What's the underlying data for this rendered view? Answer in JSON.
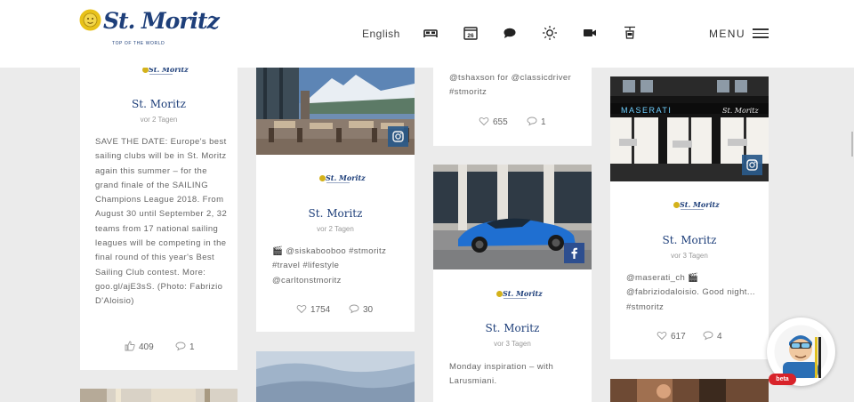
{
  "header": {
    "logo_text": "St. Moritz",
    "logo_tagline": "TOP OF THE WORLD",
    "language": "English",
    "icons": [
      "bed-icon",
      "calendar-icon",
      "chat-icon",
      "sun-icon",
      "video-camera-icon",
      "cable-car-icon"
    ],
    "calendar_day": "26",
    "menu_label": "MENU"
  },
  "cards": {
    "c1": {
      "title": "St. Moritz",
      "date": "vor 2 Tagen",
      "text": "SAVE THE DATE: Europe's best sailing clubs will be in St. Moritz again this summer – for the grand finale of the SAILING Champions League 2018. From August 30 until September 2, 32 teams from 17 national sailing leagues will be competing in the final round of this year's Best Sailing Club contest. More: goo.gl/ajE3sS. (Photo: Fabrizio D'Aloisio)",
      "likes": "409",
      "comments": "1"
    },
    "c2": {
      "title": "St. Moritz",
      "date": "vor 2 Tagen",
      "text": "🎬 @siskabooboo #stmoritz #travel #lifestyle @carltonstmoritz",
      "likes": "1754",
      "comments": "30"
    },
    "c3": {
      "text": "@tshaxson for @classicdriver #stmoritz",
      "likes": "655",
      "comments": "1"
    },
    "c4": {
      "title": "St. Moritz",
      "date": "vor 3 Tagen",
      "text": "Monday inspiration – with Larusmiani."
    },
    "c5": {
      "title": "St. Moritz",
      "date": "vor 3 Tagen",
      "text": "@maserati_ch 🎬 @fabriziodaloisio. Good night... #stmoritz",
      "likes": "617",
      "comments": "4",
      "sign1": "MASERATI",
      "sign2": "St. Moritz"
    }
  },
  "chat": {
    "badge": "beta"
  }
}
